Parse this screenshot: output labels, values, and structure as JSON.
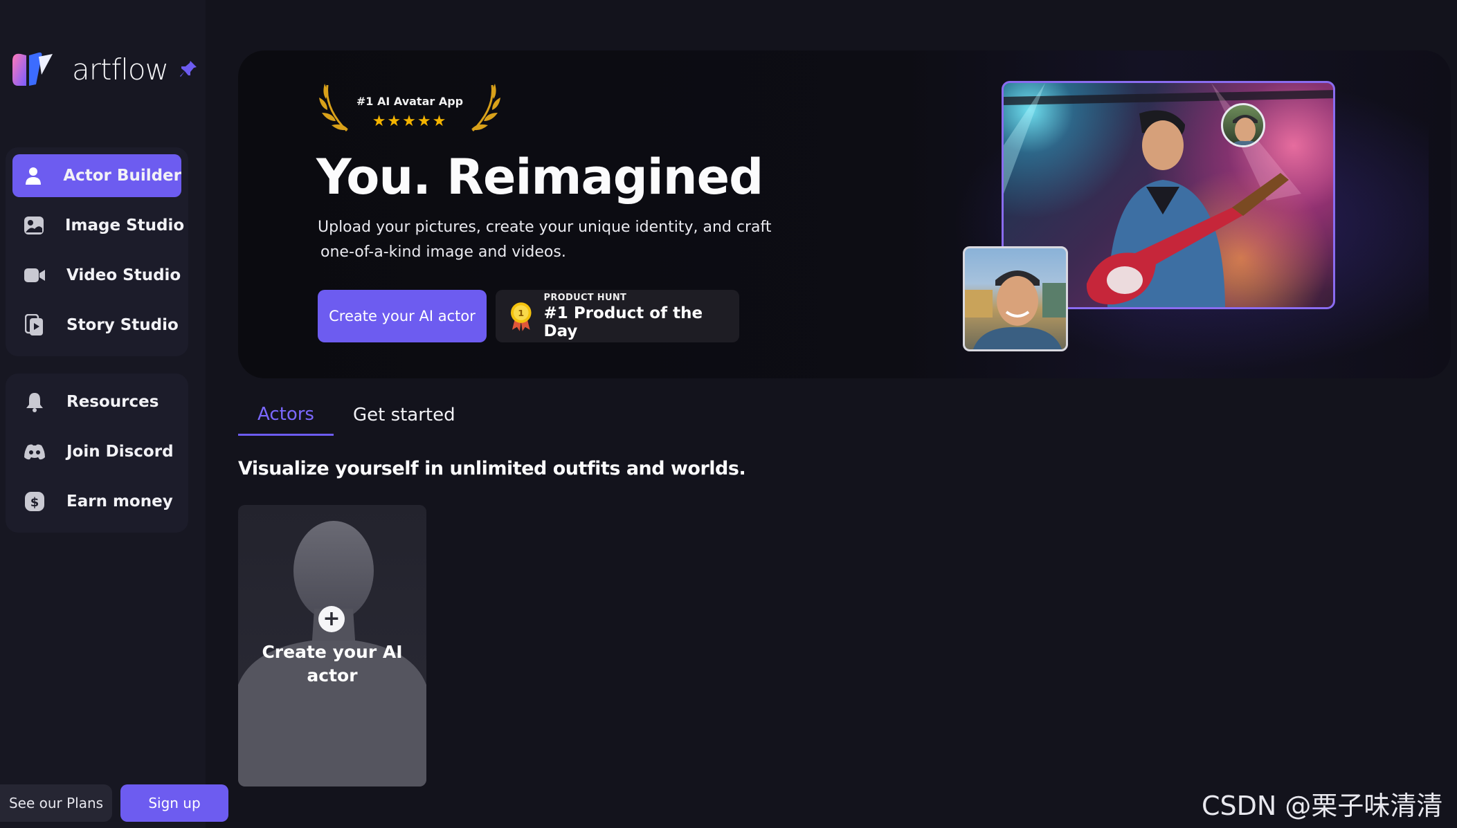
{
  "brand": {
    "name": "artflow"
  },
  "sidebar": {
    "primary": [
      {
        "label": "Actor Builder",
        "icon": "person-icon",
        "active": true
      },
      {
        "label": "Image Studio",
        "icon": "image-icon",
        "active": false
      },
      {
        "label": "Video Studio",
        "icon": "video-camera-icon",
        "active": false
      },
      {
        "label": "Story Studio",
        "icon": "story-icon",
        "active": false
      }
    ],
    "secondary": [
      {
        "label": "Resources",
        "icon": "bell-icon"
      },
      {
        "label": "Join Discord",
        "icon": "discord-icon"
      },
      {
        "label": "Earn money",
        "icon": "dollar-icon"
      }
    ],
    "plans_label": "See our Plans",
    "signup_label": "Sign up"
  },
  "hero": {
    "award_title": "#1 AI Avatar App",
    "award_stars": "★★★★★",
    "title": "You. Reimagined",
    "subtitle_line1": "Upload your pictures, create your unique identity, and craft",
    "subtitle_line2": "one-of-a-kind image and videos.",
    "cta_label": "Create your AI actor",
    "product_hunt_small": "PRODUCT HUNT",
    "product_hunt_big": "#1 Product of the Day",
    "medal_number": "1"
  },
  "tabs": [
    {
      "label": "Actors",
      "active": true
    },
    {
      "label": "Get started",
      "active": false
    }
  ],
  "tagline": "Visualize yourself in unlimited outfits and worlds.",
  "actor_card": {
    "label": "Create your AI actor"
  },
  "watermark": "CSDN @栗子味清清",
  "colors": {
    "accent": "#6d5cf0",
    "background": "#13131c",
    "sidebar": "#171722",
    "gold": "#f4b400"
  }
}
